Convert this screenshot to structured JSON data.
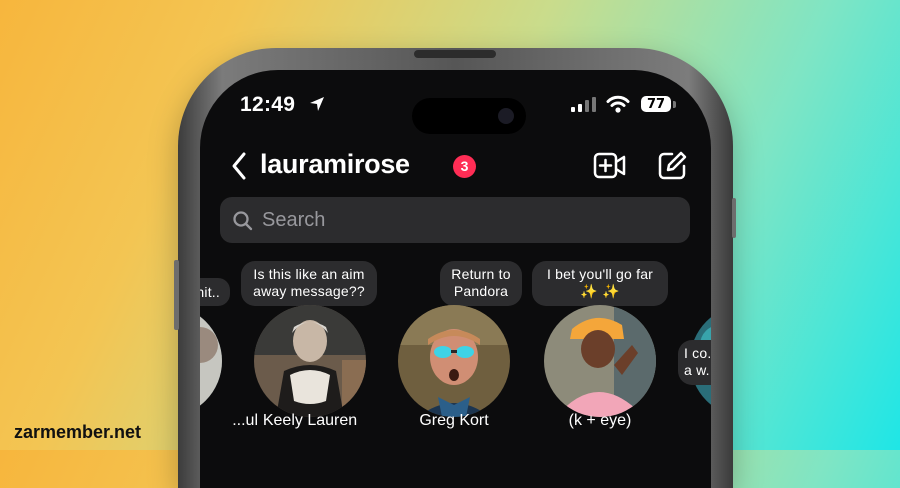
{
  "status_bar": {
    "time": "12:49",
    "battery": "77"
  },
  "header": {
    "username": "lauramirose",
    "unread_count": "3"
  },
  "search": {
    "placeholder": "Search"
  },
  "stories": [
    {
      "note": "...hit..",
      "name": "...ul"
    },
    {
      "note": "Is this like an aim away message??",
      "name": "Keely Lauren"
    },
    {
      "note": "Return to Pandora",
      "name": "Greg Kort"
    },
    {
      "note": "I bet you'll go far ✨ ✨",
      "name": "(k + eye)"
    },
    {
      "note": "I co... a w...",
      "name": ""
    }
  ],
  "watermark": "zarmember.net",
  "colors": {
    "badge": "#ff2d55",
    "search_bg": "#2c2c2e",
    "screen_bg": "#0c0c0d"
  }
}
